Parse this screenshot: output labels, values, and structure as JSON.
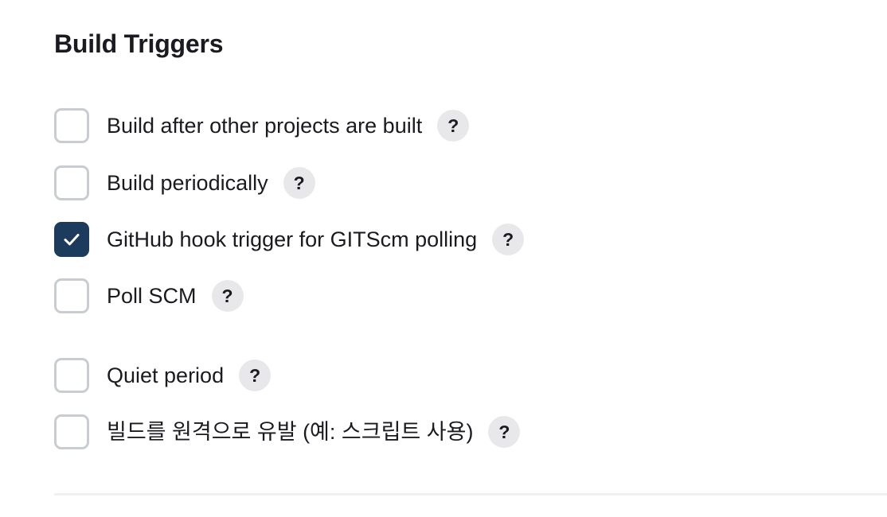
{
  "section": {
    "title": "Build Triggers"
  },
  "triggers": [
    {
      "label": "Build after other projects are built",
      "checked": false,
      "help": "?"
    },
    {
      "label": "Build periodically",
      "checked": false,
      "help": "?"
    },
    {
      "label": "GitHub hook trigger for GITScm polling",
      "checked": true,
      "help": "?"
    },
    {
      "label": "Poll SCM",
      "checked": false,
      "help": "?"
    },
    {
      "label": "Quiet period",
      "checked": false,
      "help": "?"
    },
    {
      "label": "빌드를 원격으로 유발 (예: 스크립트 사용)",
      "checked": false,
      "help": "?"
    }
  ],
  "colors": {
    "checked_fill": "#1d3b5c",
    "unchecked_border": "#c9ccd1",
    "help_bg": "#e8e8ea",
    "text": "#1a1a20"
  },
  "icons": {
    "check": "check-icon",
    "help": "help-icon"
  }
}
